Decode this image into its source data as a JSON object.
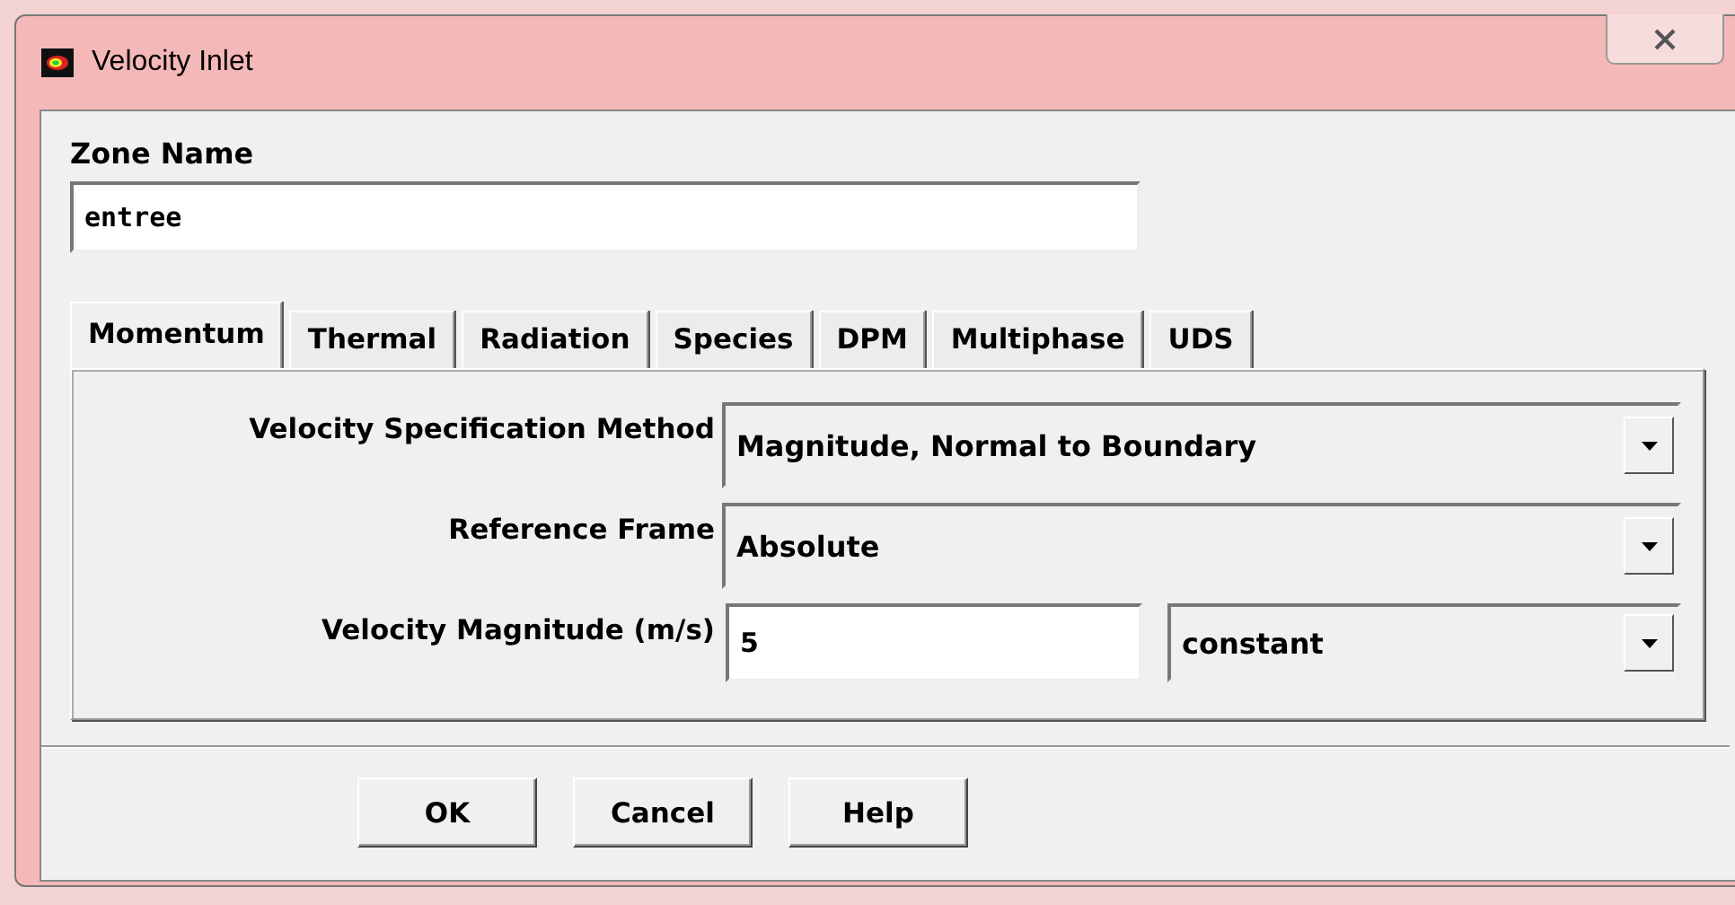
{
  "window": {
    "title": "Velocity Inlet"
  },
  "zone_name": {
    "label": "Zone Name",
    "value": "entree"
  },
  "tabs": [
    {
      "label": "Momentum",
      "selected": true
    },
    {
      "label": "Thermal",
      "selected": false
    },
    {
      "label": "Radiation",
      "selected": false
    },
    {
      "label": "Species",
      "selected": false
    },
    {
      "label": "DPM",
      "selected": false
    },
    {
      "label": "Multiphase",
      "selected": false
    },
    {
      "label": "UDS",
      "selected": false
    }
  ],
  "rows": [
    {
      "kind": "dropdown",
      "label": "Velocity Specification Method",
      "value": "Magnitude, Normal to Boundary"
    },
    {
      "kind": "dropdown",
      "label": "Reference Frame",
      "value": "Absolute"
    },
    {
      "kind": "value-profile",
      "label": "Velocity Magnitude (m/s)",
      "value": "5",
      "profile": "constant"
    }
  ],
  "buttons": [
    "OK",
    "Cancel",
    "Help"
  ]
}
